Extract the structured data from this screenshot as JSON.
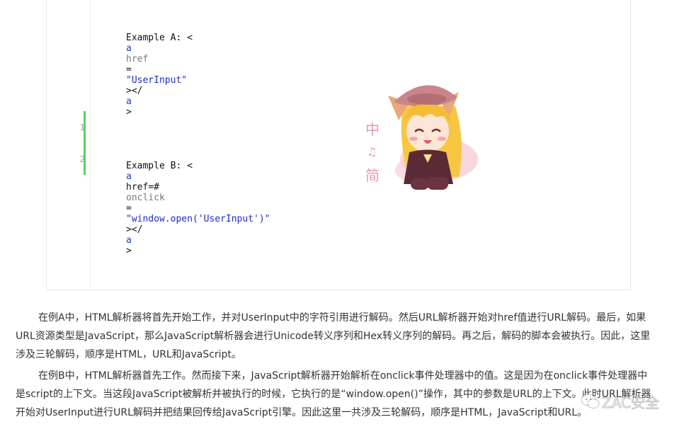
{
  "code_block": {
    "line_numbers": [
      "1",
      "2"
    ],
    "example_a": {
      "prefix": "Example A: <",
      "tag": "a",
      "attr": "href",
      "eq": "=",
      "value": "\"UserInput\"",
      "close_open": "></",
      "close_tag": "a",
      "close_end": ">"
    },
    "example_b": {
      "prefix": "Example B: <",
      "tag": "a",
      "href_plain": "href=#",
      "attr": "onclick",
      "eq": "=",
      "value": "\"window.open('UserInput')\"",
      "close_open": "></",
      "close_tag": "a",
      "close_end": ">"
    }
  },
  "sticker": {
    "text": "中 ♫ 简",
    "colors": {
      "hair": "#f7c744",
      "hat": "#c9868a",
      "outfit": "#5a2b34",
      "petals": "#f3b6c0"
    }
  },
  "article": {
    "paragraph_a": "在例A中，HTML解析器将首先开始工作，并对UserInput中的字符引用进行解码。然后URL解析器开始对href值进行URL解码。最后，如果URL资源类型是JavaScript，那么JavaScript解析器会进行Unicode转义序列和Hex转义序列的解码。再之后，解码的脚本会被执行。因此，这里涉及三轮解码，顺序是HTML，URL和JavaScript。",
    "paragraph_b": "在例B中，HTML解析器首先工作。然而接下来，JavaScript解析器开始解析在onclick事件处理器中的值。这是因为在onclick事件处理器中是script的上下文。当这段JavaScript被解析并被执行的时候，它执行的是“window.open()”操作，其中的参数是URL的上下文。此时URL解析器开始对UserInput进行URL解码并把结果回传给JavaScript引擎。因此这里一共涉及三轮解码，顺序是HTML，JavaScript和URL。"
  },
  "watermark": {
    "text": "ZAC安全",
    "icon": "wechat-icon"
  }
}
